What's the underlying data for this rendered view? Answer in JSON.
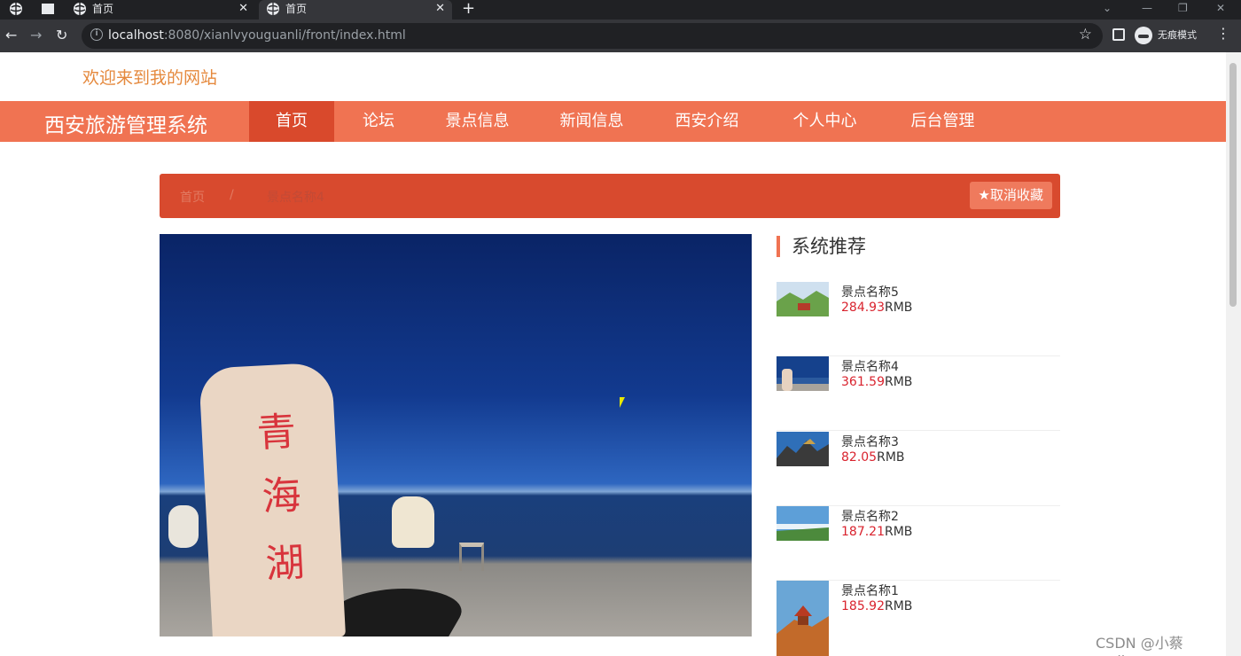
{
  "browser": {
    "tabs": [
      {
        "title": "首页",
        "active": false
      },
      {
        "title": "首页",
        "active": true
      }
    ],
    "url_host": "localhost",
    "url_rest": ":8080/xianlvyouguanli/front/index.html",
    "incognito_label": "无痕模式"
  },
  "site": {
    "welcome": "欢迎来到我的网站",
    "brand": "西安旅游管理系统",
    "nav": [
      "首页",
      "论坛",
      "景点信息",
      "新闻信息",
      "西安介绍",
      "个人中心",
      "后台管理"
    ],
    "active_nav": 0
  },
  "breadcrumb": {
    "home": "首页",
    "separator": "/",
    "current": "景点名称4",
    "fav_button": "取消收藏"
  },
  "photo": {
    "stone_text": [
      "青",
      "海",
      "湖"
    ],
    "alt": "青海湖"
  },
  "recommend": {
    "title": "系统推荐",
    "currency": "RMB",
    "items": [
      {
        "name": "景点名称5",
        "price": "284.93"
      },
      {
        "name": "景点名称4",
        "price": "361.59"
      },
      {
        "name": "景点名称3",
        "price": "82.05"
      },
      {
        "name": "景点名称2",
        "price": "187.21"
      },
      {
        "name": "景点名称1",
        "price": "185.92"
      }
    ]
  },
  "watermark": "CSDN @小蔡coding",
  "colors": {
    "nav_bg": "#f07352",
    "nav_active": "#d9492c",
    "breadcrumb_bg": "#d84a2e",
    "price": "#d9232e",
    "welcome": "#e5893d"
  }
}
